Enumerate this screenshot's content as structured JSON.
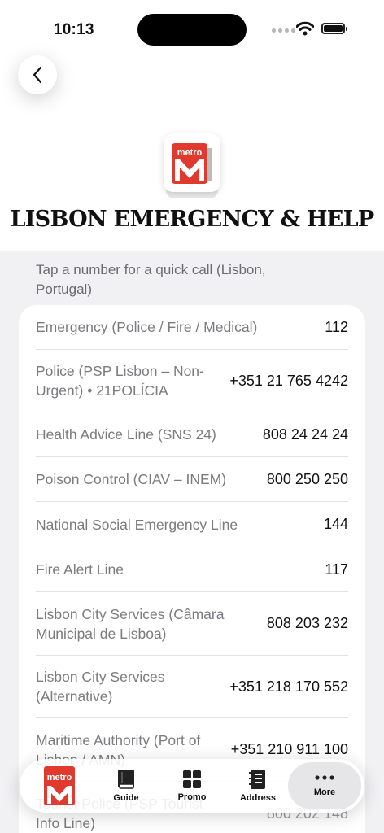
{
  "status": {
    "time": "10:13"
  },
  "header": {
    "logo_text": "metro",
    "title": "LISBON EMERGENCY & HELP"
  },
  "subtitle": "Tap a number for a quick call (Lisbon, Portugal)",
  "contacts": [
    {
      "label": "Emergency (Police / Fire / Medical)",
      "number": "112"
    },
    {
      "label": "Police (PSP Lisbon – Non-Urgent) • 21POLÍCIA",
      "number": "+351 21 765 4242"
    },
    {
      "label": "Health Advice Line (SNS 24)",
      "number": "808 24 24 24"
    },
    {
      "label": "Poison Control (CIAV – INEM)",
      "number": "800 250 250"
    },
    {
      "label": "National Social Emergency Line",
      "number": "144"
    },
    {
      "label": "Fire Alert Line",
      "number": "117"
    },
    {
      "label": "Lisbon City Services (Câmara Municipal de Lisboa)",
      "number": "808 203 232"
    },
    {
      "label": "Lisbon City Services (Alternative)",
      "number": "+351 218 170 552"
    },
    {
      "label": "Maritime Authority (Port of Lisbon / AMN)",
      "number": "+351 210 911 100"
    },
    {
      "label": "Tourist Police (PSP Tourist Info Line)",
      "number": "800 202 148"
    }
  ],
  "tabbar": {
    "home_logo_text": "metro",
    "tabs": [
      {
        "label": "Guide",
        "icon": "book-icon"
      },
      {
        "label": "Promo",
        "icon": "grid-icon"
      },
      {
        "label": "Address",
        "icon": "address-book-icon"
      },
      {
        "label": "More",
        "icon": "more-icon"
      }
    ]
  },
  "colors": {
    "brand_red": "#e03a2f",
    "background": "#f1f1f4"
  }
}
